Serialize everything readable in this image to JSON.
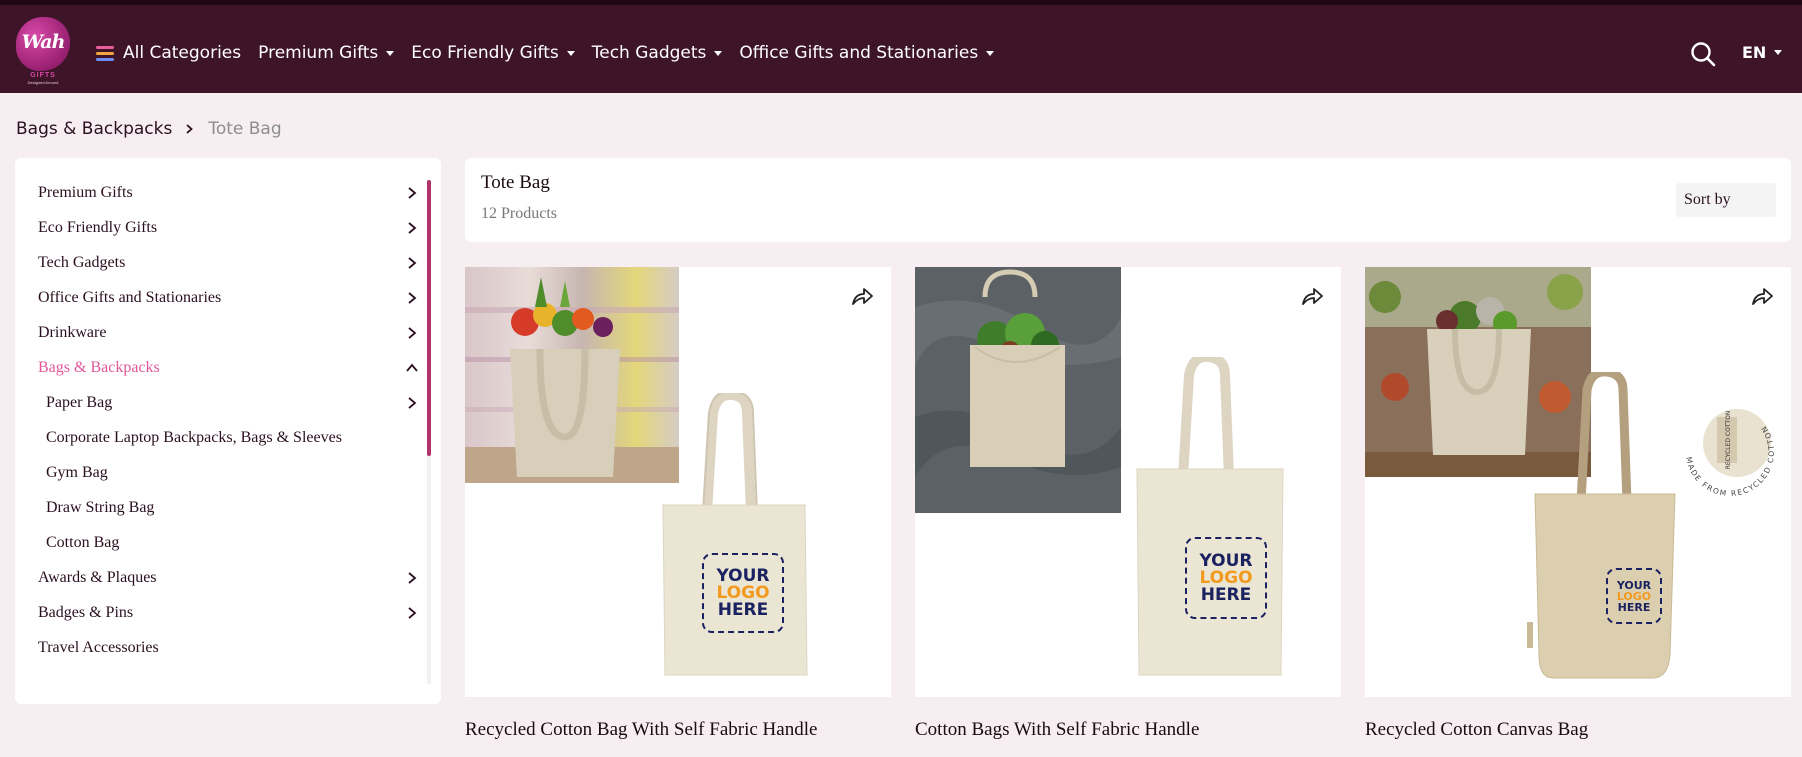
{
  "brand": {
    "logo_text": "Wah",
    "logo_sub": "GIFTS",
    "logo_tagline": "Designed Around"
  },
  "nav": {
    "all_categories": "All Categories",
    "items": [
      "Premium Gifts",
      "Eco Friendly Gifts",
      "Tech Gadgets",
      "Office Gifts and Stationaries"
    ],
    "language": "EN"
  },
  "breadcrumb": {
    "parent": "Bags & Backpacks",
    "current": "Tote Bag"
  },
  "sidebar": {
    "items": [
      {
        "label": "Premium Gifts",
        "chevron": "right"
      },
      {
        "label": "Eco Friendly Gifts",
        "chevron": "right"
      },
      {
        "label": "Tech Gadgets",
        "chevron": "right"
      },
      {
        "label": "Office Gifts and Stationaries",
        "chevron": "right"
      },
      {
        "label": "Drinkware",
        "chevron": "right"
      },
      {
        "label": "Bags & Backpacks",
        "chevron": "up",
        "active": true
      },
      {
        "label": "Paper Bag",
        "chevron": "right",
        "sub": true
      },
      {
        "label": "Corporate Laptop Backpacks, Bags & Sleeves",
        "sub": true
      },
      {
        "label": "Gym Bag",
        "sub": true
      },
      {
        "label": "Draw String Bag",
        "sub": true
      },
      {
        "label": "Cotton Bag",
        "sub": true
      },
      {
        "label": "Awards & Plaques",
        "chevron": "right"
      },
      {
        "label": "Badges & Pins",
        "chevron": "right"
      },
      {
        "label": "Travel Accessories"
      }
    ]
  },
  "listing": {
    "title": "Tote Bag",
    "count": "12 Products",
    "sort_label": "Sort by"
  },
  "products": [
    {
      "title": "Recycled Cotton Bag With Self Fabric Handle",
      "logo": [
        "YOUR",
        "LOGO",
        "HERE"
      ]
    },
    {
      "title": "Cotton Bags With Self Fabric Handle",
      "logo": [
        "YOUR",
        "LOGO",
        "HERE"
      ]
    },
    {
      "title": "Recycled Cotton Canvas Bag",
      "logo": [
        "YOUR",
        "LOGO",
        "HERE"
      ],
      "badge": "RECYCLED COTTON",
      "ring_text": "MADE FROM RECYCLED COTTON"
    }
  ],
  "colors": {
    "header_bg": "#3e1528",
    "accent": "#e2579b",
    "page_bg": "#f7eef1",
    "logo_navy": "#1b2260",
    "logo_orange": "#f29a1f"
  },
  "icons": {
    "menu": "hamburger-icon",
    "search": "search-icon",
    "share": "share-icon",
    "chevron": "chevron-right-icon"
  }
}
